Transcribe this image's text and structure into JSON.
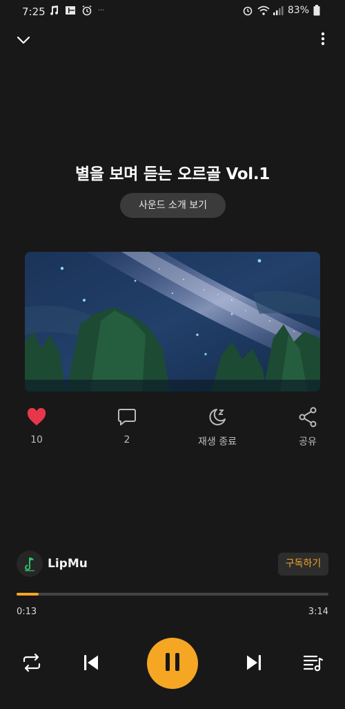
{
  "status_bar": {
    "time": "7:25",
    "battery": "83%",
    "ellipsis": "···"
  },
  "header": {
    "collapse_icon": "chevron-down-icon",
    "more_icon": "more-vert-icon"
  },
  "track": {
    "title": "별을 보며 듣는 오르골 Vol.1",
    "intro_button": "사운드 소개 보기"
  },
  "actions": [
    {
      "name": "like",
      "icon": "heart-icon",
      "label": "10"
    },
    {
      "name": "comment",
      "icon": "comment-icon",
      "label": "2"
    },
    {
      "name": "sleep-timer",
      "icon": "moon-icon",
      "label": "재생 종료"
    },
    {
      "name": "share",
      "icon": "share-icon",
      "label": "공유"
    }
  ],
  "channel": {
    "name": "LipMu",
    "subscribe_label": "구독하기"
  },
  "player": {
    "elapsed": "0:13",
    "total": "3:14",
    "progress_fraction": 0.07
  },
  "colors": {
    "accent": "#f5a623",
    "like": "#e8374a",
    "background": "#181818"
  }
}
